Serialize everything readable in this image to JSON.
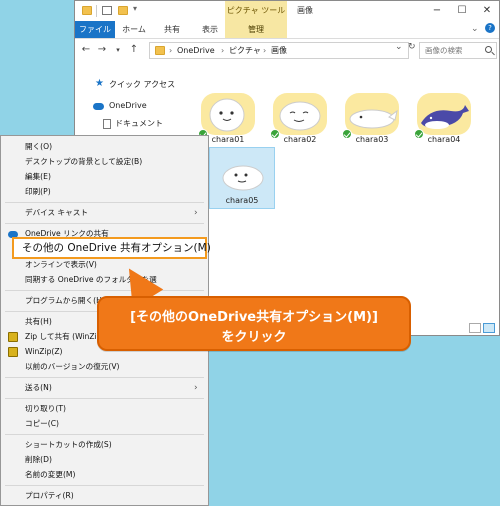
{
  "window": {
    "context_tab_header": "ピクチャ ツール",
    "title": "画像",
    "controls": {
      "minimize": "−",
      "maximize": "☐",
      "close": "✕"
    }
  },
  "ribbon": {
    "tabs": [
      "ファイル",
      "ホーム",
      "共有",
      "表示",
      "管理"
    ]
  },
  "address": {
    "crumbs": [
      "OneDrive",
      "ピクチャ",
      "画像"
    ],
    "separator": "›",
    "search_placeholder": "画像の検索"
  },
  "nav": {
    "items": [
      "クイック アクセス",
      "OneDrive",
      "ドキュメント"
    ]
  },
  "files": [
    {
      "name": "chara01",
      "selected": false
    },
    {
      "name": "chara02",
      "selected": false
    },
    {
      "name": "chara03",
      "selected": false
    },
    {
      "name": "chara04",
      "selected": false
    },
    {
      "name": "chara05",
      "selected": true
    }
  ],
  "context_menu": {
    "open": "開く(O)",
    "set_desktop_bg": "デスクトップの背景として設定(B)",
    "edit": "編集(E)",
    "print": "印刷(P)",
    "device_cast": "デバイス キャスト",
    "onedrive_share_link": "OneDrive リンクの共有",
    "more_onedrive_share": "その他の OneDrive 共有オプション(M)",
    "view_online": "オンラインで表示(V)",
    "sync_folder": "同期する OneDrive のフォルダーを選",
    "open_with": "プログラムから開く(H)",
    "share": "共有(H)",
    "zip_share": "Zip して共有 (WinZip",
    "winzip": "WinZip(Z)",
    "restore_prev": "以前のバージョンの復元(V)",
    "send_to": "送る(N)",
    "cut": "切り取り(T)",
    "copy": "コピー(C)",
    "create_shortcut": "ショートカットの作成(S)",
    "delete": "削除(D)",
    "rename": "名前の変更(M)",
    "properties": "プロパティ(R)"
  },
  "callout": {
    "line1": "[その他のOneDrive共有オプション(M)]",
    "line2": "をクリック"
  },
  "colors": {
    "desktop": "#90d3e7",
    "accent": "#1a74c7",
    "callout": "#f07818",
    "highlight_border": "#f39a1e"
  }
}
